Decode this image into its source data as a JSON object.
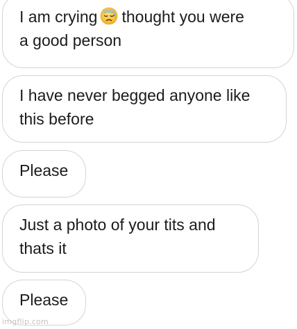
{
  "messages": [
    {
      "lines": [
        "I am crying",
        "thought you were",
        "a good person"
      ],
      "emoji": "downcast-face-with-sweat-icon"
    },
    {
      "lines": [
        "I have never begged anyone like",
        "this before"
      ]
    },
    {
      "lines": [
        "Please"
      ]
    },
    {
      "lines": [
        "Just a photo of your tits and",
        "thats it"
      ]
    },
    {
      "lines": [
        "Please"
      ]
    }
  ],
  "watermark": "imgflip.com",
  "colors": {
    "bubble_border": "#d4d4d4",
    "bubble_bg": "#ffffff",
    "text": "#1b1b1b",
    "watermark": "#c3c3c3"
  }
}
